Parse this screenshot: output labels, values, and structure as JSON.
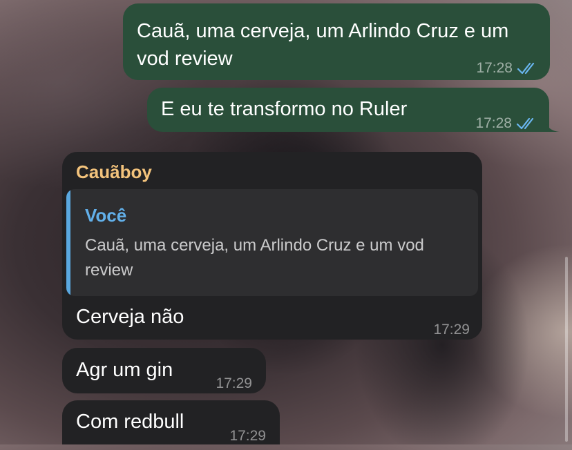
{
  "chat": {
    "outgoing": [
      {
        "text": "Cauã, uma cerveja, um Arlindo Cruz e um vod review",
        "time": "17:28"
      },
      {
        "text": "E eu te transformo no Ruler",
        "time": "17:28"
      }
    ],
    "reply_block": {
      "sender": "Cauãboy",
      "quoted_author": "Você",
      "quoted_text": "Cauã, uma cerveja, um Arlindo Cruz e um vod review",
      "text": "Cerveja não",
      "time": "17:29"
    },
    "incoming": [
      {
        "text": "Agr um gin",
        "time": "17:29"
      },
      {
        "text": "Com redbull",
        "time": "17:29"
      }
    ]
  },
  "colors": {
    "outgoing_bubble": "#2a4f3a",
    "incoming_bubble": "#222224",
    "sender_name": "#f3c37c",
    "quote_accent": "#5aa8e0",
    "read_checks": "#6ab6f0"
  },
  "icons": {
    "read_receipt": "double-check-icon"
  }
}
